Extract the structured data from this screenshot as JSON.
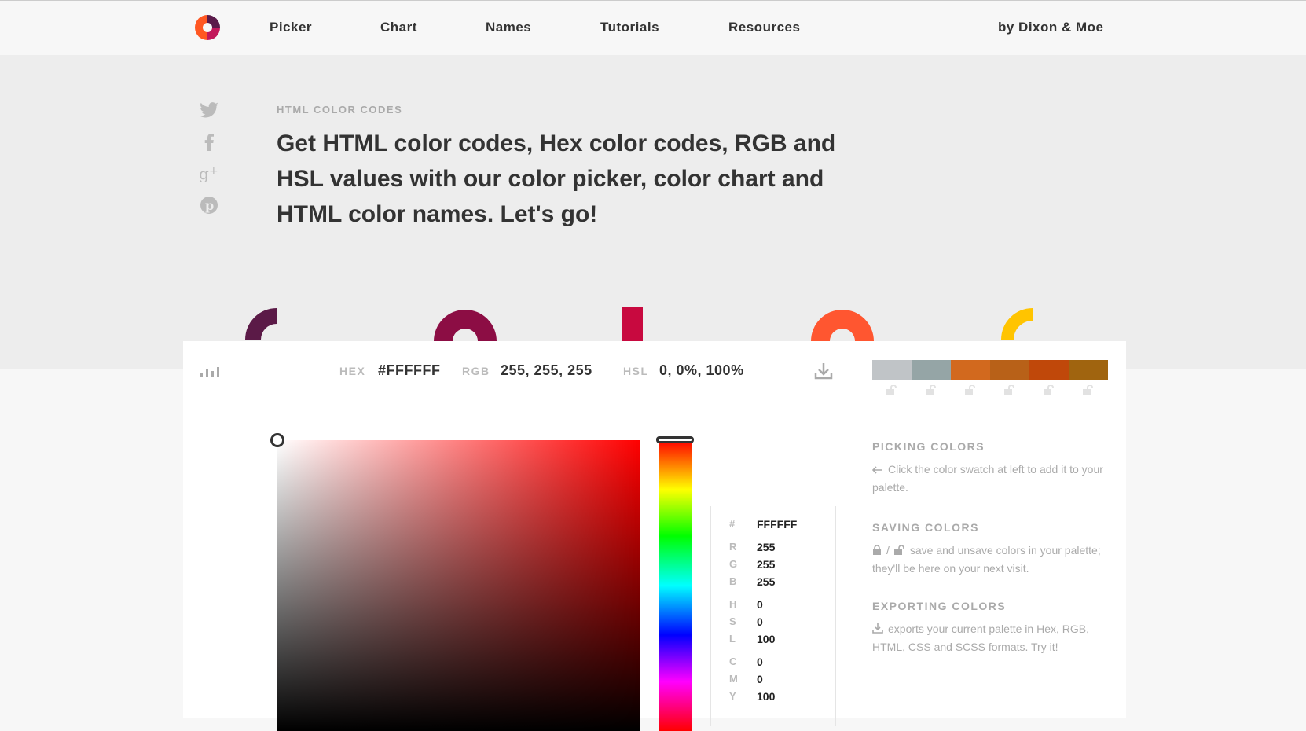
{
  "nav": {
    "items": [
      "Picker",
      "Chart",
      "Names",
      "Tutorials",
      "Resources"
    ],
    "byline": "by Dixon & Moe"
  },
  "social": {
    "icons": [
      "twitter-icon",
      "facebook-icon",
      "google-plus-icon",
      "pinterest-icon"
    ]
  },
  "hero": {
    "eyebrow": "HTML COLOR CODES",
    "headline": "Get HTML color codes, Hex color codes, RGB and HSL values with our color picker, color chart and HTML color names. Let's go!",
    "decor_colors": [
      "#5b1a47",
      "#8c0d44",
      "#c8093f",
      "#ff5630",
      "#ffc400"
    ]
  },
  "toolbar": {
    "hex_label": "HEX",
    "hex_value": "#FFFFFF",
    "rgb_label": "RGB",
    "rgb_value": "255, 255, 255",
    "hsl_label": "HSL",
    "hsl_value": "0, 0%, 100%"
  },
  "palette": {
    "colors": [
      "#c0c4c7",
      "#95a5a6",
      "#d2691e",
      "#b86118",
      "#c0480a",
      "#a0640f"
    ]
  },
  "values": {
    "hex_key": "#",
    "hex": "FFFFFF",
    "r_key": "R",
    "r": "255",
    "g_key": "G",
    "g": "255",
    "b_key": "B",
    "b": "255",
    "h_key": "H",
    "h": "0",
    "s_key": "S",
    "s": "0",
    "l_key": "L",
    "l": "100",
    "c_key": "C",
    "c": "0",
    "m_key": "M",
    "m": "0",
    "y_key": "Y",
    "y": "100"
  },
  "help": {
    "picking_title": "PICKING COLORS",
    "picking_text": "Click the color swatch at left to add it to your palette.",
    "saving_title": "SAVING COLORS",
    "saving_text": "save and unsave colors in your palette; they'll be here on your next visit.",
    "saving_sep": "/",
    "exporting_title": "EXPORTING COLORS",
    "exporting_text": "exports your current palette in Hex, RGB, HTML, CSS and SCSS formats. Try it!"
  }
}
